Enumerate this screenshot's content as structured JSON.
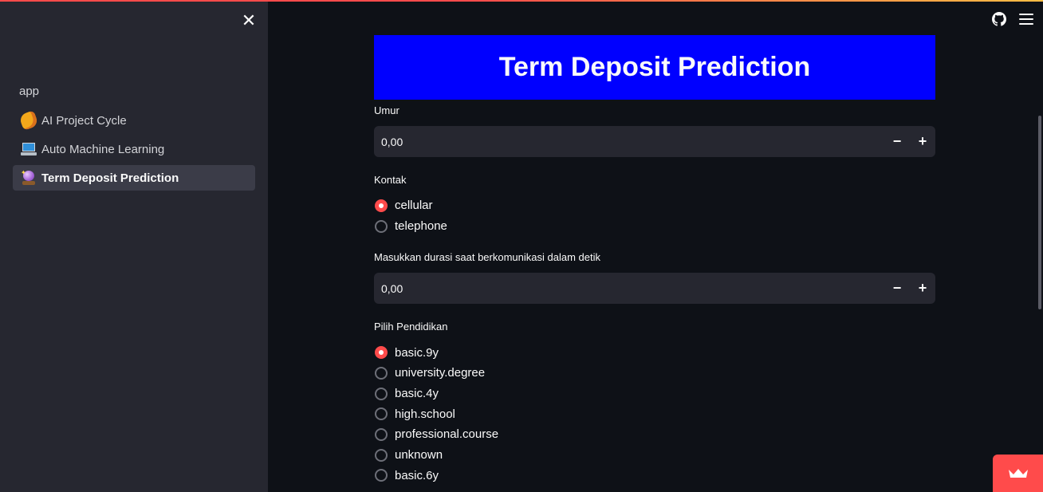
{
  "sidebar": {
    "close_label": "✕",
    "app_label": "app",
    "items": [
      {
        "label": "AI Project Cycle",
        "icon": "project-cycle-emoji-icon"
      },
      {
        "label": "Auto Machine Learning",
        "icon": "laptop-emoji-icon"
      },
      {
        "label": "Term Deposit Prediction",
        "icon": "crystal-ball-emoji-icon",
        "active": true
      }
    ]
  },
  "header": {
    "icons": [
      "github-icon",
      "hamburger-menu-icon"
    ]
  },
  "main": {
    "title": "Term Deposit Prediction",
    "banner_color": "#0000ff",
    "umur": {
      "label": "Umur",
      "value": "0,00",
      "minus": "−",
      "plus": "+"
    },
    "kontak": {
      "label": "Kontak",
      "options": [
        "cellular",
        "telephone"
      ],
      "selected": "cellular"
    },
    "durasi": {
      "label": "Masukkan durasi saat berkomunikasi dalam detik",
      "value": "0,00",
      "minus": "−",
      "plus": "+"
    },
    "pendidikan": {
      "label": "Pilih Pendidikan",
      "options": [
        "basic.9y",
        "university.degree",
        "basic.4y",
        "high.school",
        "professional.course",
        "unknown",
        "basic.6y"
      ],
      "selected": "basic.9y"
    }
  },
  "colors": {
    "background": "#0e1117",
    "sidebar": "#262730",
    "accent": "#ff4b4b",
    "input_bg": "#262730"
  }
}
